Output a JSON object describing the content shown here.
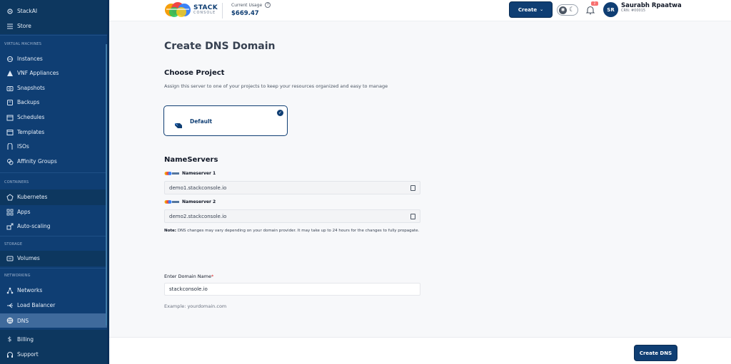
{
  "sidebar": {
    "brand": "StackAI",
    "store": "Store",
    "sections": {
      "vm": "VIRTUAL MACHINES",
      "containers": "CONTAINERS",
      "storage": "STORAGE",
      "networking": "NETWORKING"
    },
    "items": {
      "instances": "Instances",
      "vnf": "VNF Appliances",
      "snapshots": "Snapshots",
      "backups": "Backups",
      "schedules": "Schedules",
      "templates": "Templates",
      "isos": "ISOs",
      "affinity": "Affinity Groups",
      "kubernetes": "Kubernetes",
      "apps": "Apps",
      "autoscaling": "Auto-scaling",
      "volumes": "Volumes",
      "networks": "Networks",
      "loadbalancer": "Load Balancer",
      "dns": "DNS",
      "billing": "Billing",
      "support": "Support"
    }
  },
  "header": {
    "logo_line1": "STACK",
    "logo_line2": "CONSOLE",
    "usage_label": "Current Usage",
    "usage_value": "$669.47",
    "create_label": "Create",
    "user_initials": "SR",
    "user_name": "Saurabh Rpaatwa",
    "user_crn": "CRN: #00015",
    "notification_count": "2"
  },
  "main": {
    "title": "Create DNS Domain",
    "choose_project": {
      "heading": "Choose Project",
      "description": "Assign this server to one of your projects to keep your resources organized and easy to manage",
      "project_name": "Default"
    },
    "nameservers": {
      "heading": "NameServers",
      "ns1_label": "Nameserver 1",
      "ns1_value": "demo1.stackconsole.io",
      "ns2_label": "Nameserver 2",
      "ns2_value": "demo2.stackconsole.io",
      "note_prefix": "Note:",
      "note_text": " DNS changes may vary depending on your domain provider. It may take up to 24 hours for the changes to fully propagate."
    },
    "domain": {
      "label": "Enter Domain Name",
      "required_mark": "*",
      "value": "stackconsole.io",
      "example": "Example: yourdomain.com"
    },
    "submit_label": "Create DNS"
  },
  "colors": {
    "sidebar_bg": "#0f3e73",
    "sidebar_active": "#3f6a9c",
    "primary": "#0f3e73",
    "required": "#dc2626"
  }
}
